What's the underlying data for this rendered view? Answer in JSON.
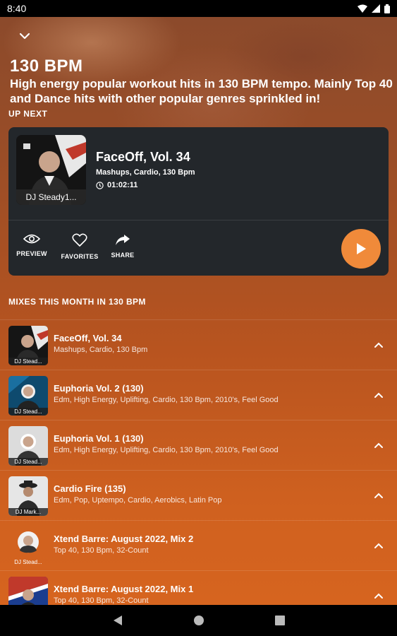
{
  "status_bar": {
    "time": "8:40"
  },
  "header": {
    "title": "130 BPM",
    "description": "High energy popular workout hits in 130 BPM tempo. Mainly Top 40 and Dance hits with other popular genres sprinkled in!"
  },
  "up_next": {
    "label": "UP NEXT",
    "artist_label": "DJ Steady1...",
    "title": "FaceOff, Vol. 34",
    "tags": "Mashups, Cardio, 130 Bpm",
    "duration": "01:02:11",
    "actions": {
      "preview": "PREVIEW",
      "favorites": "FAVORITES",
      "share": "SHARE"
    }
  },
  "mixes": {
    "section_title": "MIXES THIS MONTH IN 130 BPM",
    "items": [
      {
        "title": "FaceOff, Vol. 34",
        "tags": "Mashups, Cardio, 130 Bpm",
        "dj": "DJ Stead..."
      },
      {
        "title": "Euphoria Vol. 2 (130)",
        "tags": "Edm, High Energy, Uplifting, Cardio, 130 Bpm, 2010's, Feel Good",
        "dj": "DJ Stead..."
      },
      {
        "title": "Euphoria Vol. 1 (130)",
        "tags": "Edm, High Energy, Uplifting, Cardio, 130 Bpm, 2010's, Feel Good",
        "dj": "DJ Stead..."
      },
      {
        "title": "Cardio Fire (135)",
        "tags": "Edm, Pop, Uptempo, Cardio, Aerobics, Latin Pop",
        "dj": "DJ Mark..."
      },
      {
        "title": "Xtend Barre: August 2022, Mix 2",
        "tags": "Top 40, 130 Bpm, 32-Count",
        "dj": "DJ Stead..."
      },
      {
        "title": "Xtend Barre: August 2022, Mix 1",
        "tags": "Top 40, 130 Bpm, 32-Count",
        "dj": ""
      }
    ]
  },
  "colors": {
    "accent": "#f08a3a",
    "card": "#23272b"
  }
}
